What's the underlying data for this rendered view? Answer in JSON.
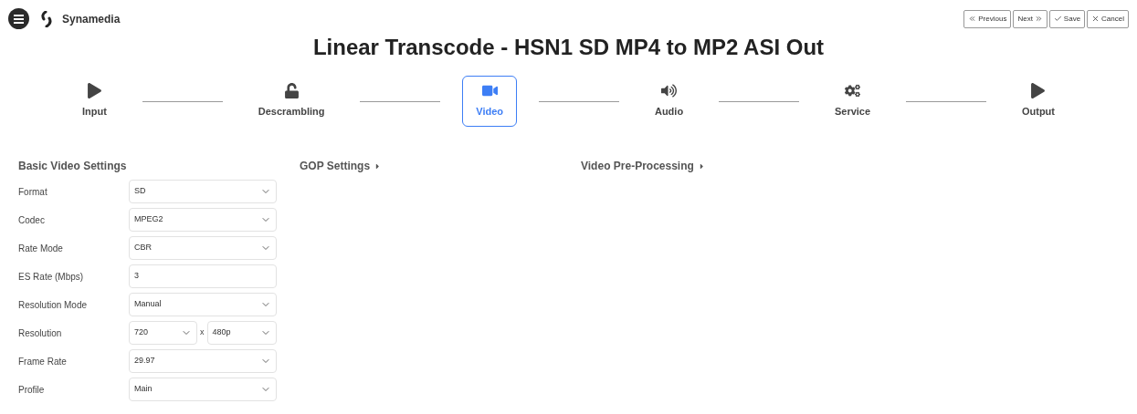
{
  "brand": {
    "name": "Synamedia"
  },
  "actions": [
    {
      "kind": "previous",
      "label": "Previous"
    },
    {
      "kind": "next",
      "label": "Next"
    },
    {
      "kind": "save",
      "label": "Save"
    },
    {
      "kind": "cancel",
      "label": "Cancel"
    }
  ],
  "title": "Linear Transcode - HSN1 SD MP4 to MP2 ASI Out",
  "steps": [
    {
      "kind": "play",
      "label": "Input",
      "selected": false
    },
    {
      "kind": "unlock",
      "label": "Descrambling",
      "selected": false
    },
    {
      "kind": "video",
      "label": "Video",
      "selected": true
    },
    {
      "kind": "audio",
      "label": "Audio",
      "selected": false
    },
    {
      "kind": "cogs",
      "label": "Service",
      "selected": false
    },
    {
      "kind": "play",
      "label": "Output",
      "selected": false
    }
  ],
  "basic_settings": {
    "heading": "Basic Video Settings",
    "fields": [
      {
        "kind": "select",
        "label": "Format",
        "value": "SD"
      },
      {
        "kind": "select",
        "label": "Codec",
        "value": "MPEG2"
      },
      {
        "kind": "select",
        "label": "Rate Mode",
        "value": "CBR"
      },
      {
        "kind": "input",
        "label": "ES Rate (Mbps)",
        "value": "3"
      },
      {
        "kind": "select",
        "label": "Resolution Mode",
        "value": "Manual"
      },
      {
        "kind": "pair",
        "label": "Resolution",
        "value": "720",
        "separator": "x",
        "value2": "480p"
      },
      {
        "kind": "select",
        "label": "Frame Rate",
        "value": "29.97"
      },
      {
        "kind": "select",
        "label": "Profile",
        "value": "Main"
      }
    ]
  },
  "collapsed_sections": [
    {
      "label": "GOP Settings",
      "expanded": false
    },
    {
      "label": "Video Pre-Processing",
      "expanded": false
    }
  ]
}
